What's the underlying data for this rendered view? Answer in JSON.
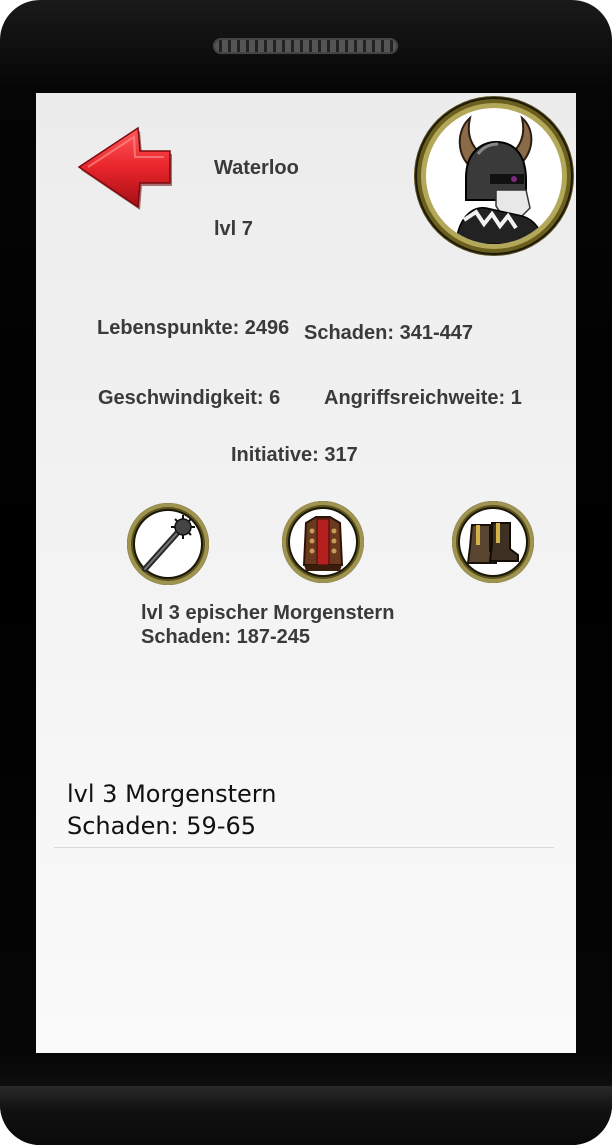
{
  "hero": {
    "name": "Waterloo",
    "level": "lvl 7"
  },
  "icons": {
    "back": "back-arrow-icon",
    "avatar": "viking-warrior-icon",
    "weapon": "morning-star-icon",
    "armor": "chest-armor-icon",
    "boots": "boots-icon"
  },
  "stats": {
    "health": "Lebenspunkte: 2496",
    "damage": "Schaden: 341-447",
    "speed": "Geschwindigkeit: 6",
    "range": "Angriffsreichweite: 1",
    "initiative": "Initiative: 317"
  },
  "selected_item": {
    "name": "lvl 3 epischer Morgenstern",
    "damage": "Schaden: 187-245"
  },
  "inventory": [
    {
      "name": "lvl 3 Morgenstern",
      "damage": "Schaden: 59-65"
    }
  ],
  "colors": {
    "accent_red": "#e8252b",
    "ring_gold": "#b3a75a",
    "text": "#3a3a3a"
  }
}
